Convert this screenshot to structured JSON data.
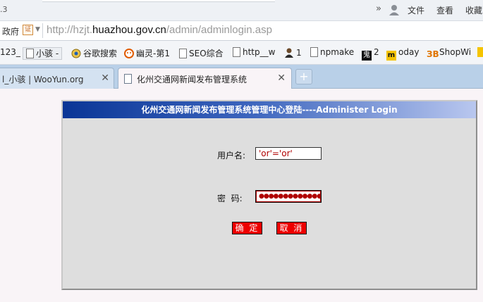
{
  "browser": {
    "version_fragment": ".3",
    "menu": [
      "文件",
      "查看",
      "收藏"
    ],
    "address": {
      "prefix": "政府",
      "cert_badge": "证",
      "url_scheme": "http://",
      "url_host_pre": "hzjt.",
      "url_host": "huazhou.gov.cn",
      "url_path": "/admin/adminlogin.asp"
    },
    "bookmarks": [
      {
        "label": "123_",
        "icon": "none"
      },
      {
        "label": "小骇 -",
        "icon": "page-icon"
      },
      {
        "label": "谷歌搜索",
        "icon": "ie-icon"
      },
      {
        "label": "幽灵-第1",
        "icon": "ghost-icon"
      },
      {
        "label": "SEO综合",
        "icon": "page-icon"
      },
      {
        "label": "http__w",
        "icon": "page-icon"
      },
      {
        "label": "1",
        "icon": "hacker-icon"
      },
      {
        "label": "npmake",
        "icon": "page-icon"
      },
      {
        "label": "2",
        "icon": "gui-icon"
      },
      {
        "label": "oday",
        "icon": "m-icon"
      },
      {
        "label": "ShopWi",
        "icon": "b-icon"
      }
    ],
    "tabs": [
      {
        "label": "l_小骇 | WooYun.org",
        "active": false
      },
      {
        "label": "化州交通网新闻发布管理系统",
        "active": true
      }
    ],
    "new_tab_symbol": "+"
  },
  "login": {
    "title": "化州交通网新闻发布管理系统管理中心登陆----Administer Login",
    "username_label": "用户名:",
    "username_value": "'or'='or'",
    "password_label": "密  码:",
    "password_mask": "●●●●●●●●●●●●●",
    "submit_label": "确 定",
    "cancel_label": "取 消"
  },
  "colors": {
    "header_gradient_start": "#0a3596",
    "header_gradient_end": "#b9c7ef",
    "button_red": "#ee0000",
    "panel_bg": "#dedede"
  }
}
